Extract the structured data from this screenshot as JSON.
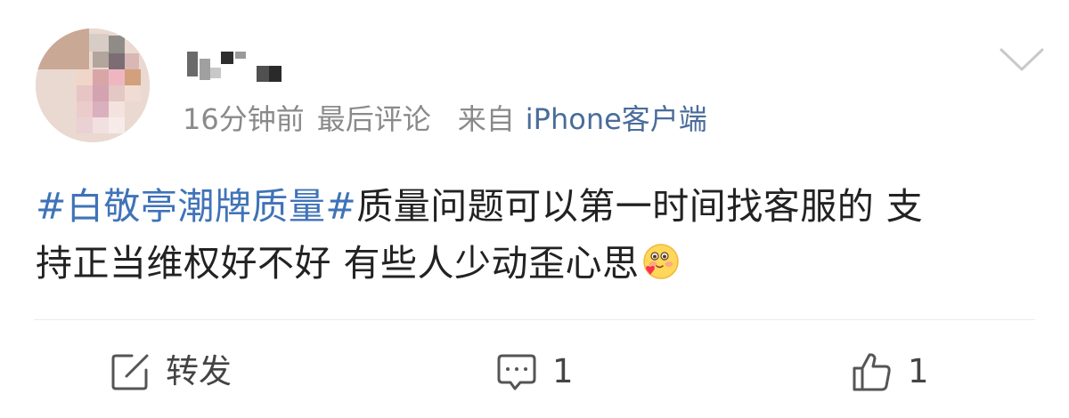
{
  "post": {
    "username": "",
    "meta": {
      "time": "16分钟前",
      "last_comment": "最后评论",
      "from_label": "来自",
      "source": "iPhone客户端"
    },
    "content": {
      "topic": "#白敬亭潮牌质量#",
      "text_line1": "质量问题可以第一时间找客服的 支",
      "text_line2": "持正当维权好不好 有些人少动歪心思"
    },
    "emoji_icon": "blush-heart-emoji",
    "actions": {
      "repost_label": "转发",
      "comment_count": "1",
      "like_count": "1"
    }
  },
  "colors": {
    "topic": "#3f73b8",
    "source": "#4a6c9a",
    "meta": "#8a8a8a",
    "text": "#222222"
  }
}
